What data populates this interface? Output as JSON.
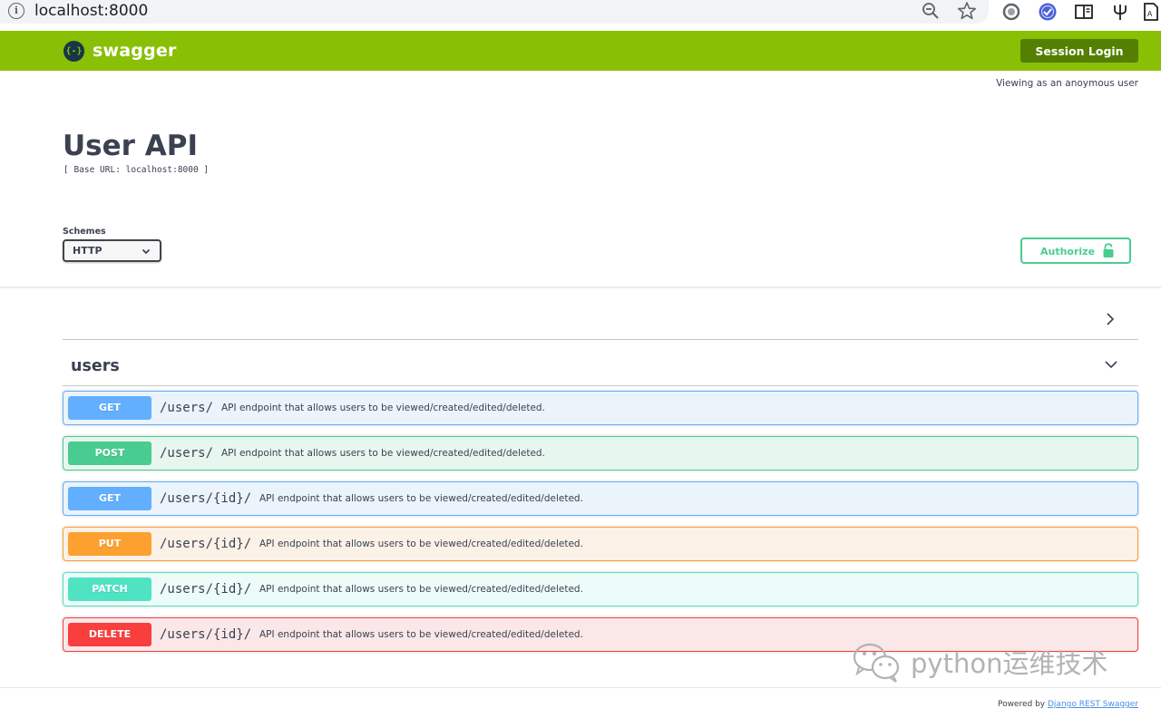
{
  "browser": {
    "url": "localhost:8000",
    "icons": [
      "info-icon",
      "zoom-out-icon",
      "bookmark-star-icon",
      "extension-circle-icon",
      "extension-check-icon",
      "reader-mode-icon",
      "extension-fork-icon",
      "extension-page-icon"
    ]
  },
  "topbar": {
    "logo_mark": "{-}",
    "logo_text": "swagger",
    "session_login": "Session Login",
    "bg_color": "#89bf04",
    "button_color": "#547f00"
  },
  "viewing_as": "Viewing as an anoymous user",
  "info": {
    "title": "User API",
    "base_url": "[ Base URL: localhost:8000 ]"
  },
  "schemes": {
    "label": "Schemes",
    "selected": "HTTP"
  },
  "authorize": {
    "label": "Authorize",
    "color": "#49cc90"
  },
  "tags": [
    {
      "name": "",
      "expanded": false
    },
    {
      "name": "users",
      "expanded": true
    }
  ],
  "operations": [
    {
      "method": "GET",
      "path": "/users/",
      "summary": "API endpoint that allows users to be viewed/created/edited/deleted.",
      "color": "#61affe",
      "bg": "#ebf3fb"
    },
    {
      "method": "POST",
      "path": "/users/",
      "summary": "API endpoint that allows users to be viewed/created/edited/deleted.",
      "color": "#49cc90",
      "bg": "#e8f6f0"
    },
    {
      "method": "GET",
      "path": "/users/{id}/",
      "summary": "API endpoint that allows users to be viewed/created/edited/deleted.",
      "color": "#61affe",
      "bg": "#ebf3fb"
    },
    {
      "method": "PUT",
      "path": "/users/{id}/",
      "summary": "API endpoint that allows users to be viewed/created/edited/deleted.",
      "color": "#fca130",
      "bg": "#fbf1e6"
    },
    {
      "method": "PATCH",
      "path": "/users/{id}/",
      "summary": "API endpoint that allows users to be viewed/created/edited/deleted.",
      "color": "#50e3c2",
      "bg": "#edfcf9"
    },
    {
      "method": "DELETE",
      "path": "/users/{id}/",
      "summary": "API endpoint that allows users to be viewed/created/edited/deleted.",
      "color": "#f93e3e",
      "bg": "#fae7e7"
    }
  ],
  "watermark": {
    "text": "python运维技术"
  },
  "footer": {
    "prefix": "Powered by ",
    "link": "Django REST Swagger"
  }
}
